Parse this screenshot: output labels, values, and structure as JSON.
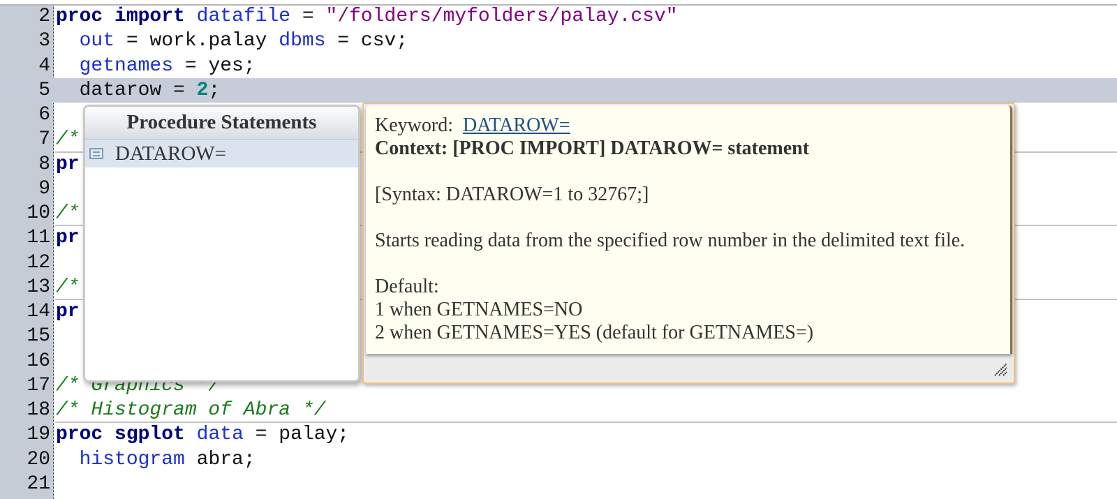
{
  "editor": {
    "lines": [
      {
        "num": "2",
        "segments": [
          {
            "t": "proc import",
            "c": "kw-proc"
          },
          {
            "t": " "
          },
          {
            "t": "datafile",
            "c": "kw-opt"
          },
          {
            "t": " = "
          },
          {
            "t": "\"/folders/myfolders/palay.csv\"",
            "c": "str"
          }
        ]
      },
      {
        "num": "3",
        "segments": [
          {
            "t": "  "
          },
          {
            "t": "out",
            "c": "kw-opt"
          },
          {
            "t": " = work.palay "
          },
          {
            "t": "dbms",
            "c": "kw-opt"
          },
          {
            "t": " = csv;"
          }
        ]
      },
      {
        "num": "4",
        "segments": [
          {
            "t": "  "
          },
          {
            "t": "getnames",
            "c": "kw-opt"
          },
          {
            "t": " = yes;"
          }
        ]
      },
      {
        "num": "5",
        "current": true,
        "segments": [
          {
            "t": "  datarow = "
          },
          {
            "t": "2",
            "c": "num"
          },
          {
            "t": ";"
          }
        ]
      },
      {
        "num": "6",
        "segments": []
      },
      {
        "num": "7",
        "segments": [
          {
            "t": "/*",
            "c": "cmt"
          }
        ]
      },
      {
        "num": "8",
        "segments": [
          {
            "t": "pr",
            "c": "kw-proc"
          }
        ]
      },
      {
        "num": "9",
        "segments": []
      },
      {
        "num": "10",
        "segments": [
          {
            "t": "/*",
            "c": "cmt"
          }
        ]
      },
      {
        "num": "11",
        "segments": [
          {
            "t": "pr",
            "c": "kw-proc"
          }
        ]
      },
      {
        "num": "12",
        "segments": []
      },
      {
        "num": "13",
        "segments": [
          {
            "t": "/*",
            "c": "cmt"
          }
        ]
      },
      {
        "num": "14",
        "segments": [
          {
            "t": "pr",
            "c": "kw-proc"
          }
        ]
      },
      {
        "num": "15",
        "segments": []
      },
      {
        "num": "16",
        "segments": []
      },
      {
        "num": "17",
        "segments": [
          {
            "t": "/* Graphics */",
            "c": "cmt"
          }
        ]
      },
      {
        "num": "18",
        "segments": [
          {
            "t": "/* Histogram of Abra */",
            "c": "cmt"
          }
        ]
      },
      {
        "num": "19",
        "segments": [
          {
            "t": "proc sgplot",
            "c": "kw-proc"
          },
          {
            "t": " "
          },
          {
            "t": "data",
            "c": "kw-opt"
          },
          {
            "t": " = palay;"
          }
        ]
      },
      {
        "num": "20",
        "segments": [
          {
            "t": "  "
          },
          {
            "t": "histogram",
            "c": "kw-opt"
          },
          {
            "t": " abra;"
          }
        ]
      },
      {
        "num": "21",
        "segments": []
      }
    ]
  },
  "autocomplete": {
    "header": "Procedure Statements",
    "items": [
      {
        "label": "DATAROW=",
        "icon": "statement-icon",
        "selected": true
      }
    ]
  },
  "help": {
    "keyword_label": "Keyword:",
    "keyword_link": "DATAROW=",
    "context": "Context: [PROC IMPORT] DATAROW= statement",
    "syntax": "[Syntax: DATAROW=1 to 32767;]",
    "description": "Starts reading data from the specified row number in the delimited text file.",
    "default_label": "Default:",
    "default_lines": [
      "1 when GETNAMES=NO",
      "2 when GETNAMES=YES (default for GETNAMES=)"
    ]
  },
  "colors": {
    "keyword_proc": "#000080",
    "keyword_option": "#1a2fd6",
    "string": "#800080",
    "number": "#008080",
    "comment": "#1b7c1b",
    "current_line": "#c6ccd8",
    "help_border": "#f0c27e",
    "help_background": "#fefff0"
  }
}
